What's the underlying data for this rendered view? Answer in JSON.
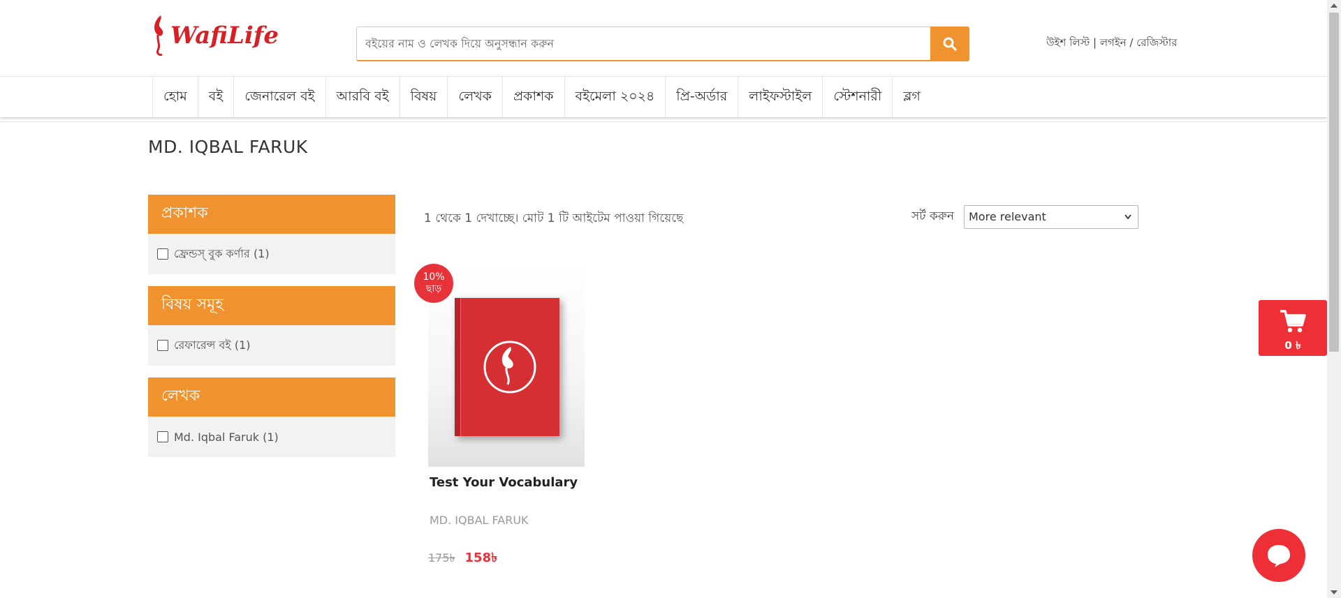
{
  "header": {
    "logo_text": "WafiLife",
    "search_placeholder": "বইয়ের নাম ও লেখক দিয়ে অনুসন্ধান করুন",
    "account": {
      "wishlist": "উইশ লিস্ট",
      "sep1": " | ",
      "login": "লগইন",
      "sep2": " / ",
      "register": "রেজিস্টার"
    }
  },
  "nav": [
    "হোম",
    "বই",
    "জেনারেল বই",
    "আরবি বই",
    "বিষয়",
    "লেখক",
    "প্রকাশক",
    "বইমেলা ২০২৪",
    "প্রি-অর্ডার",
    "লাইফস্টাইল",
    "স্টেশনারী",
    "ব্লগ"
  ],
  "page": {
    "title": "MD. IQBAL FARUK"
  },
  "filters": [
    {
      "heading": "প্রকাশক",
      "option": "ফ্রেন্ডস্ বুক কর্ণার (1)"
    },
    {
      "heading": "বিষয় সমূহ",
      "option": "রেফারেন্স বই (1)"
    },
    {
      "heading": "লেখক",
      "option": "Md. Iqbal Faruk (1)"
    }
  ],
  "results": {
    "showing": "1 থেকে 1 দেখাচ্ছে। মোট 1 টি আইটেম পাওয়া গিয়েছে",
    "sort_label": "সর্ট করুন",
    "sort_value": "More relevant"
  },
  "product": {
    "badge_line1": "10%",
    "badge_line2": "ছাড়",
    "title": "Test Your Vocabulary",
    "author": "MD. IQBAL FARUK",
    "old_price": "175৳",
    "new_price": "158৳"
  },
  "cart": {
    "count": "0 ৳"
  },
  "colors": {
    "accent_orange": "#f0922e",
    "brand_red": "#ee2f36",
    "book_red": "#d62f33"
  },
  "icons": {
    "search": "search-icon",
    "cart": "cart-icon",
    "chat": "chat-icon",
    "dropdown": "chevron-down-icon"
  }
}
